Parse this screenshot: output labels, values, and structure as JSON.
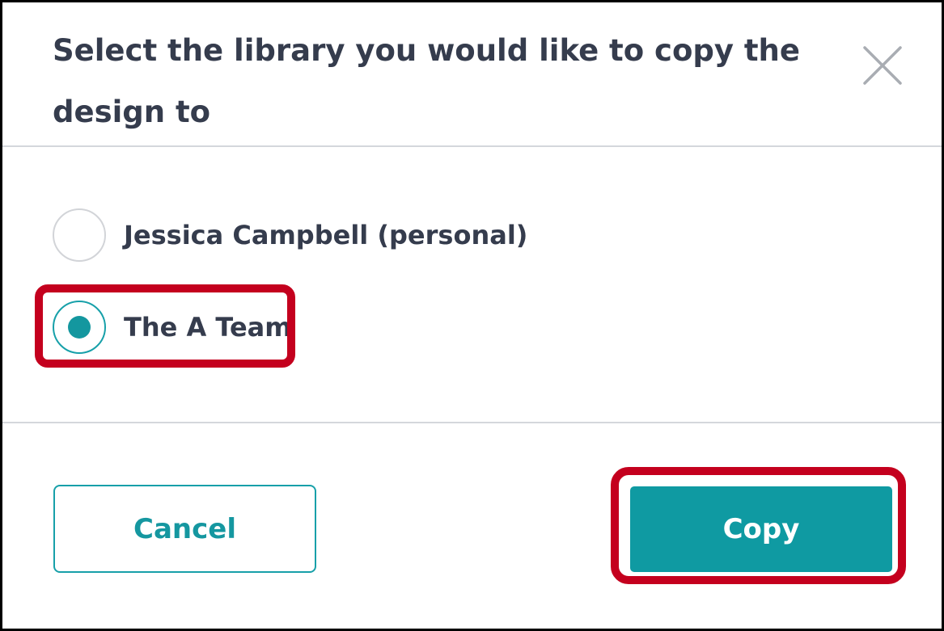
{
  "dialog": {
    "title": "Select the library you would like to copy the design to",
    "close_icon": "close-icon",
    "options": [
      {
        "label": "Jessica Campbell (personal)",
        "selected": false
      },
      {
        "label": "The A Team",
        "selected": true
      }
    ],
    "cancel_label": "Cancel",
    "copy_label": "Copy"
  },
  "colors": {
    "accent": "#0f9aa2",
    "text": "#353c4d",
    "highlight": "#c4001e",
    "divider": "#d4d7dc"
  }
}
